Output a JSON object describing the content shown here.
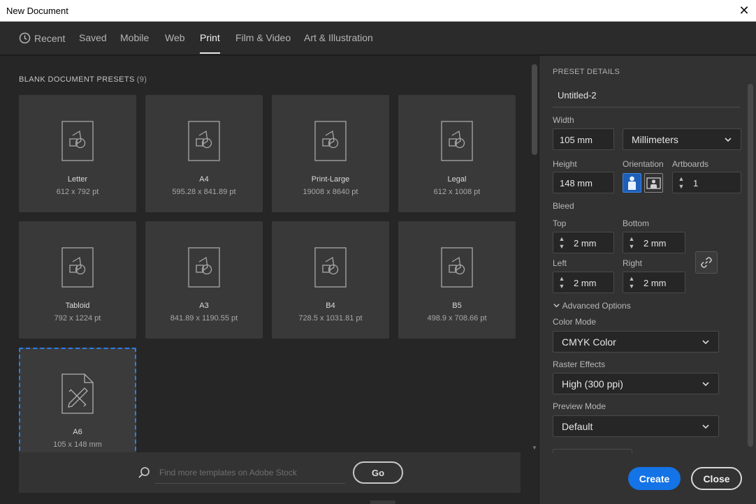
{
  "window": {
    "title": "New Document",
    "close_glyph": "✕"
  },
  "tabs": [
    {
      "label": "Recent",
      "icon": "clock-icon"
    },
    {
      "label": "Saved"
    },
    {
      "label": "Mobile"
    },
    {
      "label": "Web"
    },
    {
      "label": "Print",
      "active": true
    },
    {
      "label": "Film & Video"
    },
    {
      "label": "Art & Illustration"
    }
  ],
  "presets": {
    "heading": "BLANK DOCUMENT PRESETS",
    "count": "(9)",
    "items": [
      {
        "name": "Letter",
        "size": "612 x 792 pt"
      },
      {
        "name": "A4",
        "size": "595.28 x 841.89 pt"
      },
      {
        "name": "Print-Large",
        "size": "19008 x 8640 pt"
      },
      {
        "name": "Legal",
        "size": "612 x 1008 pt"
      },
      {
        "name": "Tabloid",
        "size": "792 x 1224 pt"
      },
      {
        "name": "A3",
        "size": "841.89 x 1190.55 pt"
      },
      {
        "name": "B4",
        "size": "728.5 x 1031.81 pt"
      },
      {
        "name": "B5",
        "size": "498.9 x 708.66 pt"
      },
      {
        "name": "A6",
        "size": "105 x 148 mm",
        "selected": true
      }
    ]
  },
  "search": {
    "placeholder": "Find more templates on Adobe Stock",
    "go_label": "Go"
  },
  "details": {
    "heading": "PRESET DETAILS",
    "doc_name": "Untitled-2",
    "width_label": "Width",
    "width_value": "105 mm",
    "units_value": "Millimeters",
    "height_label": "Height",
    "height_value": "148 mm",
    "orientation_label": "Orientation",
    "artboards_label": "Artboards",
    "artboards_value": "1",
    "bleed_label": "Bleed",
    "top_label": "Top",
    "top_value": "2 mm",
    "bottom_label": "Bottom",
    "bottom_value": "2 mm",
    "left_label": "Left",
    "left_value": "2 mm",
    "right_label": "Right",
    "right_value": "2 mm",
    "advanced_label": "Advanced Options",
    "color_mode_label": "Color Mode",
    "color_mode_value": "CMYK Color",
    "raster_label": "Raster Effects",
    "raster_value": "High (300 ppi)",
    "preview_label": "Preview Mode",
    "preview_value": "Default"
  },
  "actions": {
    "create_label": "Create",
    "close_label": "Close"
  },
  "colors": {
    "accent": "#1473e6",
    "selection": "#2d7ee8",
    "panel": "#323232",
    "canvas": "#262626"
  }
}
